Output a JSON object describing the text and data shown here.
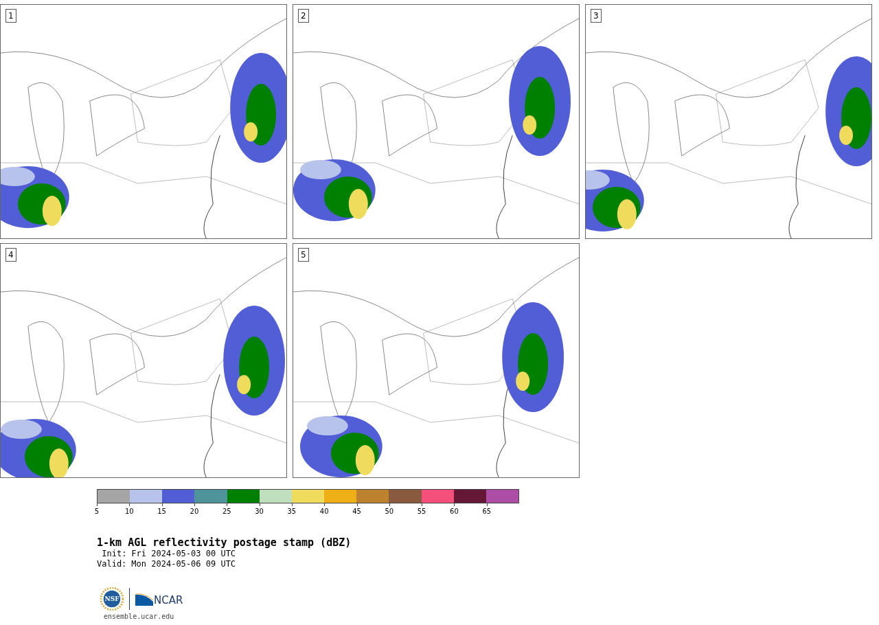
{
  "panels": [
    {
      "label": "1"
    },
    {
      "label": "2"
    },
    {
      "label": "3"
    },
    {
      "label": "4"
    },
    {
      "label": "5"
    }
  ],
  "colorbar": {
    "bins": [
      {
        "color": "#a5a5a5",
        "label": "5"
      },
      {
        "color": "#b8c3ec",
        "label": "10"
      },
      {
        "color": "#515ed6",
        "label": "15"
      },
      {
        "color": "#4e949a",
        "label": "20"
      },
      {
        "color": "#008000",
        "label": "25"
      },
      {
        "color": "#bfdfbf",
        "label": "30"
      },
      {
        "color": "#efdc5c",
        "label": "35"
      },
      {
        "color": "#efaf17",
        "label": "40"
      },
      {
        "color": "#bc822e",
        "label": "45"
      },
      {
        "color": "#8a5a3e",
        "label": "50"
      },
      {
        "color": "#f4507b",
        "label": "55"
      },
      {
        "color": "#641836",
        "label": "60"
      },
      {
        "color": "#ad4da6",
        "label": "65"
      }
    ]
  },
  "title": "1-km AGL reflectivity postage stamp (dBZ)",
  "times": [
    {
      "label": "Init:",
      "value": "Fri 2024-05-03 00 UTC"
    },
    {
      "label": "Valid:",
      "value": "Mon 2024-05-06 09 UTC"
    }
  ],
  "logos": {
    "left": "NSF",
    "right": "NCAR"
  },
  "footer": "ensemble.ucar.edu"
}
